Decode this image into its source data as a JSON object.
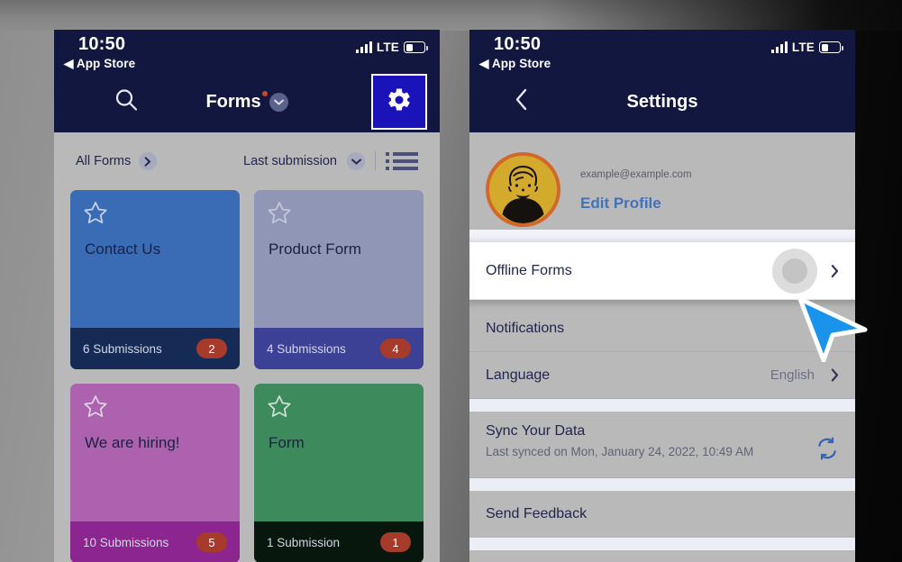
{
  "status_bar": {
    "time": "10:50",
    "back_label": "App Store",
    "back_arrow": "◀",
    "network": "LTE",
    "signal_icon": "signal-bars-icon",
    "battery_icon": "battery-icon"
  },
  "left_panel": {
    "navbar": {
      "title": "Forms",
      "has_notification_dot": true,
      "search_icon": "search-icon",
      "dropdown_icon": "chevron-down-icon",
      "gear_icon": "gear-icon",
      "gear_button_color": "#1a13ba",
      "navbar_color": "#11173f"
    },
    "filter_bar": {
      "all_forms_label": "All Forms",
      "all_forms_icon": "chevron-right-icon",
      "sort_label": "Last submission",
      "sort_icon": "chevron-down-icon",
      "view_toggle_icon": "list-view-icon"
    },
    "cards": [
      {
        "title": "Contact Us",
        "submissions": "6 Submissions",
        "badge": "2",
        "body_color": "#3a6cb5",
        "foot_color": "#152a55",
        "star_icon": "star-outline-icon"
      },
      {
        "title": "Product Form",
        "submissions": "4 Submissions",
        "badge": "4",
        "body_color": "#9096b5",
        "foot_color": "#3c4196",
        "star_icon": "star-outline-icon"
      },
      {
        "title": "We are hiring!",
        "submissions": "10 Submissions",
        "badge": "5",
        "body_color": "#ad62b0",
        "foot_color": "#8c2590",
        "star_icon": "star-outline-icon"
      },
      {
        "title": "Form",
        "submissions": "1 Submission",
        "badge": "1",
        "body_color": "#3d8b5c",
        "foot_color": "#07170d",
        "star_icon": "star-outline-icon"
      }
    ]
  },
  "right_panel": {
    "navbar": {
      "title": "Settings",
      "back_icon": "chevron-left-icon"
    },
    "profile": {
      "email": "example@example.com",
      "edit_label": "Edit Profile",
      "avatar_icon": "user-avatar-icon",
      "avatar_ring_color": "#d2672a",
      "avatar_bg_color": "#d4aa2c"
    },
    "rows": [
      {
        "label": "Offline Forms",
        "value": "",
        "chevron": "chevron-right-icon",
        "highlighted": true
      },
      {
        "label": "Notifications",
        "value": "",
        "chevron": "chevron-right-icon",
        "highlighted": false
      },
      {
        "label": "Language",
        "value": "English",
        "chevron": "chevron-right-icon",
        "highlighted": false
      }
    ],
    "sync": {
      "label": "Sync Your Data",
      "sub": "Last synced on Mon, January 24, 2022, 10:49 AM",
      "icon": "sync-refresh-icon",
      "icon_color": "#3b63b0"
    },
    "feedback": {
      "label": "Send Feedback"
    }
  },
  "cursor": {
    "icon": "mouse-pointer-icon",
    "color": "#1a93ec"
  }
}
